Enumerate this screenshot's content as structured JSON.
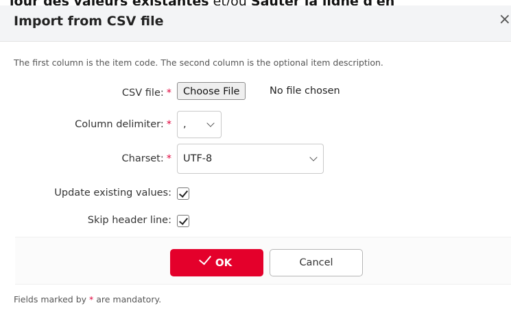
{
  "background": {
    "bold_1": "jour des valeurs existantes",
    "plain": " et/ou ",
    "bold_2": "Sauter la ligne d'en"
  },
  "dialog": {
    "title": "Import from CSV file",
    "close_glyph": "×",
    "intro": "The first column is the item code. The second column is the optional item description.",
    "required_marker": "*",
    "fields": {
      "csv_file": {
        "label": "CSV file:",
        "button": "Choose File",
        "status": "No file chosen"
      },
      "delimiter": {
        "label": "Column delimiter:",
        "value": ","
      },
      "charset": {
        "label": "Charset:",
        "value": "UTF-8"
      },
      "update_existing": {
        "label": "Update existing values:",
        "checked": true
      },
      "skip_header": {
        "label": "Skip header line:",
        "checked": true
      }
    },
    "buttons": {
      "ok": "OK",
      "cancel": "Cancel"
    },
    "mandatory_note": {
      "prefix": "Fields marked by ",
      "suffix": " are mandatory."
    }
  },
  "colors": {
    "accent": "#e4002b",
    "header_bg": "#f3f4f6"
  }
}
